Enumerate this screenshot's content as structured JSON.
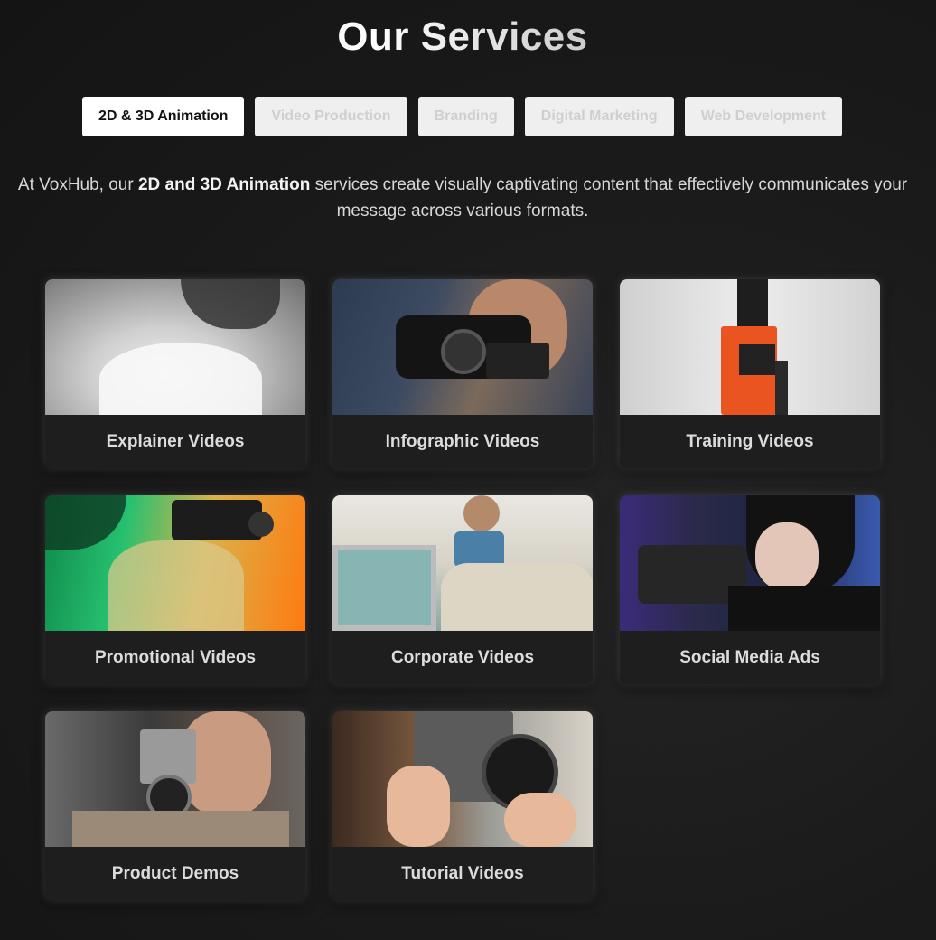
{
  "header": {
    "title": "Our Services"
  },
  "tabs": [
    {
      "label": "2D & 3D Animation",
      "active": true
    },
    {
      "label": "Video Production",
      "active": false
    },
    {
      "label": "Branding",
      "active": false
    },
    {
      "label": "Digital Marketing",
      "active": false
    },
    {
      "label": "Web Development",
      "active": false
    }
  ],
  "intro": {
    "part1": "At VoxHub, our ",
    "bold": "2D and 3D Animation",
    "part2": " services create visually captivating content that effectively communicates your message across various formats."
  },
  "cards": [
    {
      "label": "Explainer Videos",
      "image": "woman-bw-photo"
    },
    {
      "label": "Infographic Videos",
      "image": "man-with-camcorder-photo"
    },
    {
      "label": "Training Videos",
      "image": "orange-camera-photo"
    },
    {
      "label": "Promotional Videos",
      "image": "person-with-film-camera-photo"
    },
    {
      "label": "Corporate Videos",
      "image": "woman-with-tv-photo"
    },
    {
      "label": "Social Media Ads",
      "image": "woman-with-video-camera-photo"
    },
    {
      "label": "Product Demos",
      "image": "man-with-vintage-camera-photo"
    },
    {
      "label": "Tutorial Videos",
      "image": "hands-with-camera-photo"
    }
  ],
  "colors": {
    "background": "#1b1b1b",
    "tab_active_bg": "#ffffff",
    "tab_inactive_bg": "#efefef",
    "tab_inactive_text": "#cfcfcf",
    "card_bg": "#1e1e1e"
  }
}
